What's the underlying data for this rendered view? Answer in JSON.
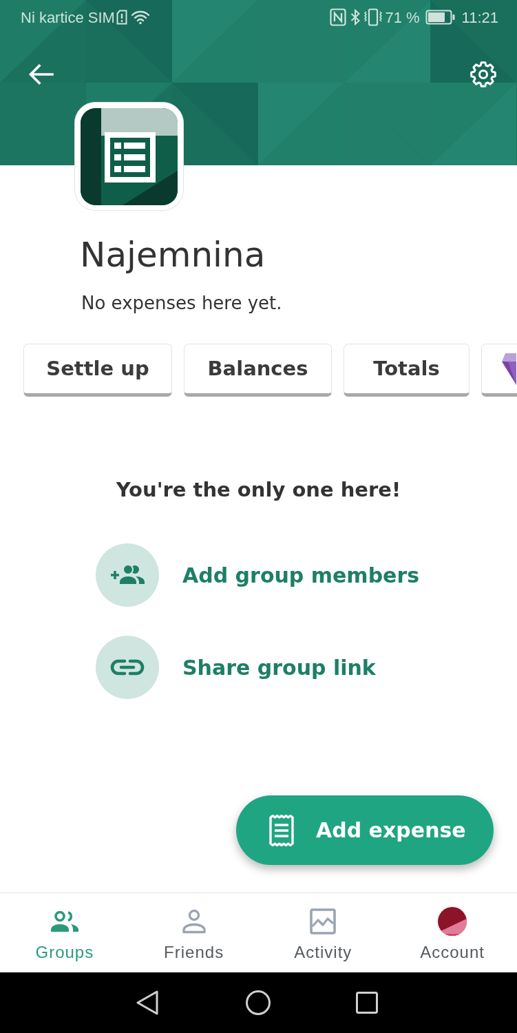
{
  "status_bar": {
    "carrier": "Ni kartice SIM",
    "battery": "71 %",
    "time": "11:21"
  },
  "group": {
    "name": "Najemnina",
    "subtitle": "No expenses here yet."
  },
  "action_buttons": [
    {
      "kind": "text",
      "label": "Settle up"
    },
    {
      "kind": "text",
      "label": "Balances"
    },
    {
      "kind": "text",
      "label": "Totals"
    },
    {
      "kind": "gem"
    }
  ],
  "empty_state": {
    "title": "You're the only one here!",
    "actions": [
      {
        "kind": "members",
        "label": "Add group members"
      },
      {
        "kind": "link",
        "label": "Share group link"
      }
    ]
  },
  "fab": {
    "label": "Add expense"
  },
  "bottom_nav": [
    {
      "kind": "groups",
      "label": "Groups",
      "selected": true
    },
    {
      "kind": "friends",
      "label": "Friends",
      "selected": false
    },
    {
      "kind": "activity",
      "label": "Activity",
      "selected": false
    },
    {
      "kind": "account",
      "label": "Account",
      "selected": false
    }
  ]
}
